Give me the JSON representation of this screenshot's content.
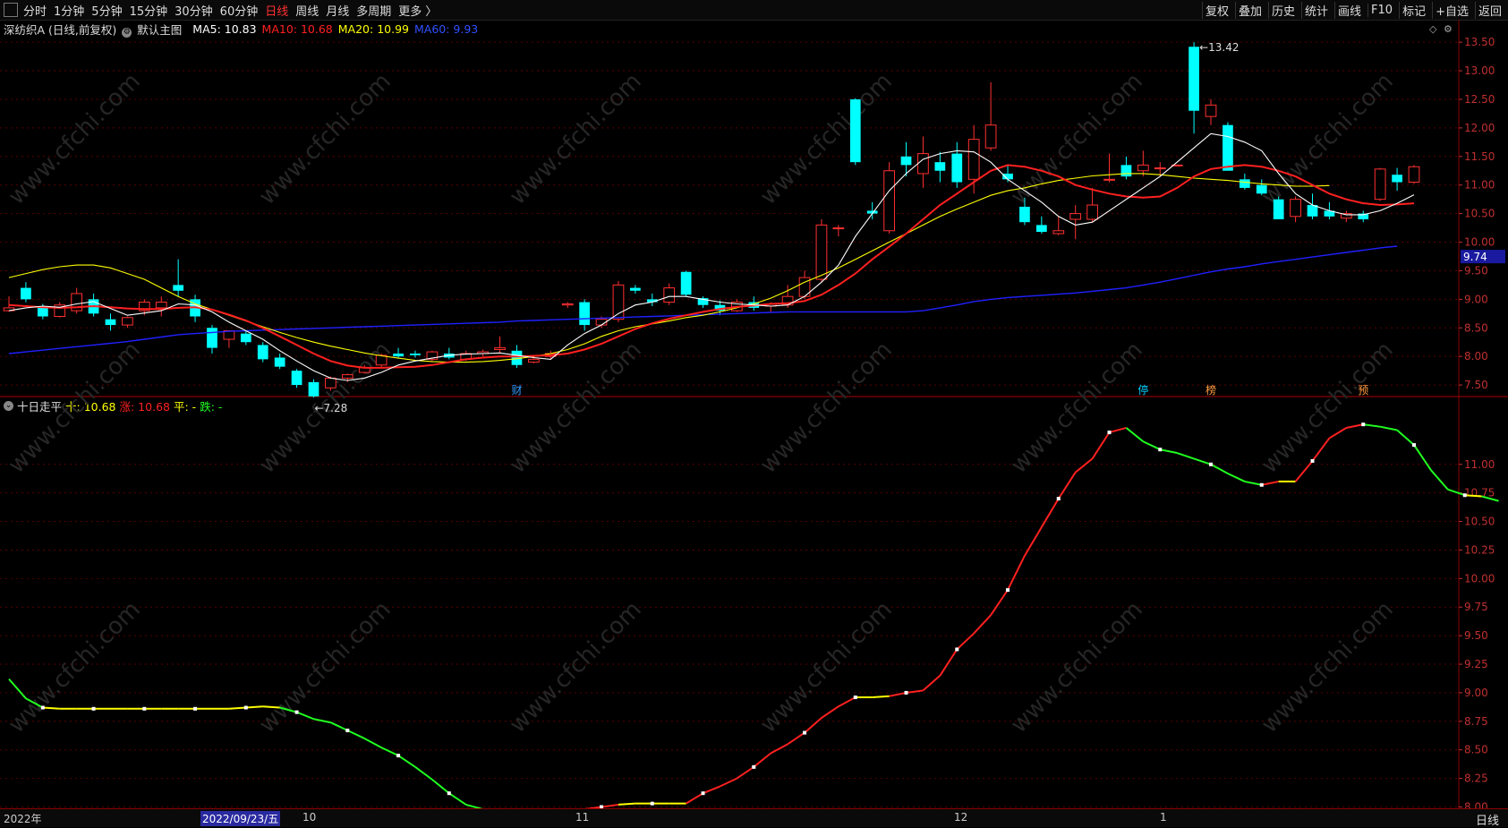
{
  "toolbar": {
    "periods": [
      "分时",
      "1分钟",
      "5分钟",
      "15分钟",
      "30分钟",
      "60分钟",
      "日线",
      "周线",
      "月线",
      "多周期",
      "更多 〉"
    ],
    "active_period": "日线",
    "right_items": [
      "复权",
      "叠加",
      "历史",
      "统计",
      "画线",
      "F10",
      "标记",
      "+自选",
      "返回"
    ]
  },
  "main_legend": {
    "stock": "深纺织A (日线,前复权)",
    "template": "默认主图",
    "ma5": "MA5: 10.83",
    "ma10": "MA10: 10.68",
    "ma20": "MA20: 10.99",
    "ma60": "MA60: 9.93"
  },
  "sub_legend": {
    "name": "十日走平",
    "shi": "十: 10.68",
    "zhang": "涨: 10.68",
    "ping": "平: -",
    "die": "跌: -"
  },
  "price_axis": [
    "13.50",
    "13.00",
    "12.50",
    "12.00",
    "11.50",
    "11.00",
    "10.50",
    "10.00",
    "9.50",
    "9.00",
    "8.50",
    "8.00",
    "7.50"
  ],
  "price_tag": "9.74",
  "sub_axis": [
    "11.00",
    "10.75",
    "10.50",
    "10.25",
    "10.00",
    "9.75",
    "9.50",
    "9.25",
    "9.00",
    "8.75",
    "8.50",
    "8.25",
    "8.00"
  ],
  "annotations": {
    "high": "13.42",
    "low": "7.28"
  },
  "event_markers": [
    "财",
    "停",
    "榜",
    "预"
  ],
  "bottom_axis": {
    "year": "2022年",
    "cursor_date": "2022/09/23/五",
    "months": [
      "10",
      "11",
      "12",
      "1"
    ],
    "period_label": "日线"
  },
  "watermark": "www.cfchi.com",
  "colors": {
    "ma5": "#ffffff",
    "ma10": "#ff2020",
    "ma20": "#ffff00",
    "ma60": "#2020ff",
    "up": "#ff3030",
    "down": "#00ffff"
  },
  "chart_data": {
    "type": "candlestick",
    "ohlc": [
      [
        8.8,
        9.05,
        8.78,
        8.85
      ],
      [
        9.2,
        9.3,
        8.95,
        9.0
      ],
      [
        8.85,
        8.92,
        8.65,
        8.7
      ],
      [
        8.7,
        8.95,
        8.68,
        8.9
      ],
      [
        8.8,
        9.2,
        8.75,
        9.1
      ],
      [
        9.0,
        9.1,
        8.7,
        8.75
      ],
      [
        8.65,
        8.75,
        8.45,
        8.55
      ],
      [
        8.55,
        8.7,
        8.5,
        8.68
      ],
      [
        8.8,
        9.0,
        8.72,
        8.95
      ],
      [
        8.85,
        9.05,
        8.7,
        8.95
      ],
      [
        9.25,
        9.7,
        9.05,
        9.15
      ],
      [
        9.0,
        9.08,
        8.6,
        8.7
      ],
      [
        8.5,
        8.55,
        8.05,
        8.15
      ],
      [
        8.3,
        8.45,
        8.15,
        8.45
      ],
      [
        8.4,
        8.45,
        8.2,
        8.25
      ],
      [
        8.2,
        8.25,
        7.9,
        7.95
      ],
      [
        7.98,
        8.05,
        7.78,
        7.82
      ],
      [
        7.75,
        7.78,
        7.45,
        7.5
      ],
      [
        7.55,
        7.6,
        7.28,
        7.3
      ],
      [
        7.45,
        7.65,
        7.4,
        7.62
      ],
      [
        7.62,
        7.7,
        7.55,
        7.68
      ],
      [
        7.72,
        7.85,
        7.7,
        7.8
      ],
      [
        7.85,
        8.05,
        7.8,
        8.02
      ],
      [
        8.05,
        8.15,
        7.98,
        8.0
      ],
      [
        8.05,
        8.1,
        7.98,
        8.02
      ],
      [
        7.95,
        8.1,
        7.9,
        8.08
      ],
      [
        8.05,
        8.15,
        7.95,
        7.98
      ],
      [
        7.95,
        8.1,
        7.92,
        8.05
      ],
      [
        8.05,
        8.12,
        8.0,
        8.08
      ],
      [
        8.12,
        8.35,
        8.05,
        8.15
      ],
      [
        8.1,
        8.2,
        7.8,
        7.85
      ],
      [
        7.9,
        8.0,
        7.88,
        7.95
      ],
      [
        8.0,
        8.1,
        7.95,
        8.05
      ],
      [
        8.9,
        8.95,
        8.85,
        8.92
      ],
      [
        8.95,
        9.0,
        8.45,
        8.55
      ],
      [
        8.55,
        8.7,
        8.5,
        8.65
      ],
      [
        8.65,
        9.32,
        8.6,
        9.25
      ],
      [
        9.2,
        9.25,
        9.1,
        9.15
      ],
      [
        9.0,
        9.1,
        8.88,
        8.95
      ],
      [
        8.95,
        9.28,
        8.9,
        9.2
      ],
      [
        9.48,
        9.5,
        9.05,
        9.08
      ],
      [
        9.02,
        9.05,
        8.85,
        8.9
      ],
      [
        8.9,
        8.98,
        8.72,
        8.8
      ],
      [
        8.8,
        9.0,
        8.78,
        8.95
      ],
      [
        8.95,
        9.05,
        8.8,
        8.85
      ],
      [
        8.88,
        8.95,
        8.78,
        8.92
      ],
      [
        8.9,
        9.25,
        8.85,
        9.05
      ],
      [
        9.05,
        9.5,
        9.0,
        9.38
      ],
      [
        9.35,
        10.4,
        9.3,
        10.3
      ],
      [
        10.25,
        10.3,
        10.1,
        10.25
      ],
      [
        12.5,
        12.52,
        11.35,
        11.4
      ],
      [
        10.55,
        10.7,
        10.4,
        10.5
      ],
      [
        10.2,
        11.4,
        10.15,
        11.25
      ],
      [
        11.5,
        11.75,
        11.15,
        11.35
      ],
      [
        11.2,
        11.85,
        10.95,
        11.55
      ],
      [
        11.4,
        11.58,
        11.05,
        11.25
      ],
      [
        11.55,
        11.75,
        10.95,
        11.05
      ],
      [
        11.1,
        12.05,
        10.85,
        11.8
      ],
      [
        11.65,
        12.8,
        11.6,
        12.05
      ],
      [
        11.2,
        11.35,
        11.05,
        11.1
      ],
      [
        10.62,
        10.78,
        10.3,
        10.35
      ],
      [
        10.3,
        10.45,
        10.15,
        10.18
      ],
      [
        10.15,
        10.45,
        10.12,
        10.2
      ],
      [
        10.4,
        10.65,
        10.05,
        10.5
      ],
      [
        10.4,
        10.95,
        10.35,
        10.65
      ],
      [
        11.1,
        11.55,
        11.05,
        11.1
      ],
      [
        11.35,
        11.5,
        11.1,
        11.15
      ],
      [
        11.25,
        11.6,
        11.15,
        11.35
      ],
      [
        11.3,
        11.4,
        11.15,
        11.3
      ],
      [
        11.35,
        11.35,
        11.35,
        11.35
      ],
      [
        13.42,
        13.5,
        11.9,
        12.3
      ],
      [
        12.2,
        12.5,
        12.05,
        12.4
      ],
      [
        12.05,
        12.1,
        11.35,
        11.25
      ],
      [
        11.1,
        11.2,
        10.92,
        10.95
      ],
      [
        11.0,
        11.1,
        10.82,
        10.85
      ],
      [
        10.75,
        10.8,
        10.4,
        10.4
      ],
      [
        10.45,
        10.8,
        10.35,
        10.75
      ],
      [
        10.65,
        10.85,
        10.4,
        10.45
      ],
      [
        10.55,
        10.7,
        10.4,
        10.45
      ],
      [
        10.42,
        10.55,
        10.35,
        10.5
      ],
      [
        10.5,
        10.55,
        10.35,
        10.4
      ],
      [
        10.75,
        11.3,
        10.72,
        11.28
      ],
      [
        11.18,
        11.3,
        10.9,
        11.05
      ],
      [
        11.05,
        11.35,
        11.02,
        11.32
      ]
    ],
    "ma5": [
      8.8,
      8.85,
      8.88,
      8.86,
      8.92,
      8.96,
      8.84,
      8.72,
      8.76,
      8.8,
      8.92,
      8.9,
      8.78,
      8.6,
      8.45,
      8.3,
      8.1,
      7.92,
      7.75,
      7.62,
      7.58,
      7.62,
      7.72,
      7.85,
      7.92,
      7.97,
      8.02,
      8.04,
      8.05,
      8.06,
      8.02,
      7.98,
      7.95,
      8.2,
      8.4,
      8.55,
      8.75,
      8.9,
      8.95,
      9.05,
      9.05,
      9.0,
      8.95,
      8.92,
      8.9,
      8.88,
      8.9,
      9.05,
      9.3,
      9.6,
      10.1,
      10.5,
      10.9,
      11.2,
      11.45,
      11.55,
      11.6,
      11.58,
      11.4,
      11.1,
      10.9,
      10.7,
      10.45,
      10.3,
      10.35,
      10.55,
      10.75,
      10.95,
      11.15,
      11.4,
      11.65,
      11.9,
      11.85,
      11.75,
      11.6,
      11.2,
      10.85,
      10.65,
      10.55,
      10.48,
      10.48,
      10.55,
      10.68,
      10.83
    ],
    "ma10": [
      8.9,
      8.88,
      8.86,
      8.85,
      8.86,
      8.88,
      8.86,
      8.84,
      8.83,
      8.83,
      8.85,
      8.86,
      8.82,
      8.73,
      8.63,
      8.5,
      8.35,
      8.2,
      8.05,
      7.92,
      7.84,
      7.8,
      7.8,
      7.81,
      7.82,
      7.85,
      7.9,
      7.95,
      7.98,
      8.0,
      8.0,
      8.01,
      8.02,
      8.05,
      8.12,
      8.22,
      8.35,
      8.48,
      8.58,
      8.66,
      8.72,
      8.78,
      8.83,
      8.87,
      8.89,
      8.92,
      8.93,
      8.97,
      9.08,
      9.25,
      9.45,
      9.7,
      9.92,
      10.15,
      10.4,
      10.65,
      10.85,
      11.05,
      11.25,
      11.35,
      11.32,
      11.25,
      11.15,
      11.0,
      10.92,
      10.85,
      10.8,
      10.78,
      10.8,
      10.95,
      11.15,
      11.28,
      11.32,
      11.35,
      11.32,
      11.25,
      11.15,
      11.0,
      10.85,
      10.75,
      10.68,
      10.65,
      10.66,
      10.68
    ],
    "ma20": [
      9.38,
      9.45,
      9.52,
      9.57,
      9.6,
      9.6,
      9.55,
      9.45,
      9.35,
      9.2,
      9.05,
      8.92,
      8.82,
      8.72,
      8.62,
      8.52,
      8.42,
      8.33,
      8.25,
      8.18,
      8.12,
      8.06,
      8.01,
      7.97,
      7.93,
      7.91,
      7.9,
      7.9,
      7.91,
      7.93,
      7.96,
      8.0,
      8.05,
      8.12,
      8.22,
      8.35,
      8.45,
      8.52,
      8.57,
      8.62,
      8.68,
      8.72,
      8.78,
      8.85,
      8.92,
      9.02,
      9.15,
      9.3,
      9.42,
      9.55,
      9.7,
      9.85,
      10.0,
      10.15,
      10.3,
      10.45,
      10.58,
      10.7,
      10.82,
      10.9,
      10.95,
      11.02,
      11.08,
      11.12,
      11.16,
      11.18,
      11.2,
      11.2,
      11.18,
      11.15,
      11.12,
      11.1,
      11.08,
      11.05,
      11.02,
      11.0,
      10.98,
      10.98,
      10.99
    ],
    "ma60": [
      8.05,
      8.08,
      8.11,
      8.14,
      8.17,
      8.2,
      8.23,
      8.26,
      8.3,
      8.34,
      8.38,
      8.4,
      8.42,
      8.44,
      8.45,
      8.46,
      8.47,
      8.48,
      8.49,
      8.5,
      8.51,
      8.52,
      8.53,
      8.54,
      8.55,
      8.56,
      8.57,
      8.58,
      8.59,
      8.6,
      8.62,
      8.63,
      8.64,
      8.65,
      8.66,
      8.67,
      8.68,
      8.69,
      8.7,
      8.71,
      8.72,
      8.73,
      8.74,
      8.75,
      8.76,
      8.77,
      8.78,
      8.78,
      8.78,
      8.78,
      8.78,
      8.78,
      8.78,
      8.78,
      8.8,
      8.85,
      8.9,
      8.96,
      9.0,
      9.03,
      9.05,
      9.07,
      9.09,
      9.11,
      9.14,
      9.17,
      9.2,
      9.25,
      9.3,
      9.36,
      9.42,
      9.48,
      9.53,
      9.57,
      9.62,
      9.66,
      9.7,
      9.74,
      9.78,
      9.82,
      9.86,
      9.9,
      9.93
    ],
    "sub_line": [
      9.12,
      8.95,
      8.87,
      8.86,
      8.86,
      8.86,
      8.86,
      8.86,
      8.86,
      8.86,
      8.86,
      8.86,
      8.86,
      8.86,
      8.87,
      8.88,
      8.87,
      8.83,
      8.77,
      8.74,
      8.67,
      8.6,
      8.52,
      8.45,
      8.35,
      8.24,
      8.12,
      8.02,
      7.98,
      7.97,
      7.95,
      7.95,
      7.95,
      7.96,
      7.98,
      8.0,
      8.02,
      8.03,
      8.03,
      8.03,
      8.03,
      8.12,
      8.18,
      8.25,
      8.35,
      8.47,
      8.55,
      8.65,
      8.78,
      8.88,
      8.96,
      8.96,
      8.97,
      9.0,
      9.02,
      9.15,
      9.38,
      9.52,
      9.68,
      9.9,
      10.2,
      10.45,
      10.7,
      10.93,
      11.05,
      11.28,
      11.32,
      11.2,
      11.13,
      11.1,
      11.05,
      11.0,
      10.92,
      10.85,
      10.82,
      10.85,
      10.85,
      11.03,
      11.23,
      11.32,
      11.35,
      11.33,
      11.3,
      11.17,
      10.95,
      10.78,
      10.73,
      10.72,
      10.68
    ]
  }
}
